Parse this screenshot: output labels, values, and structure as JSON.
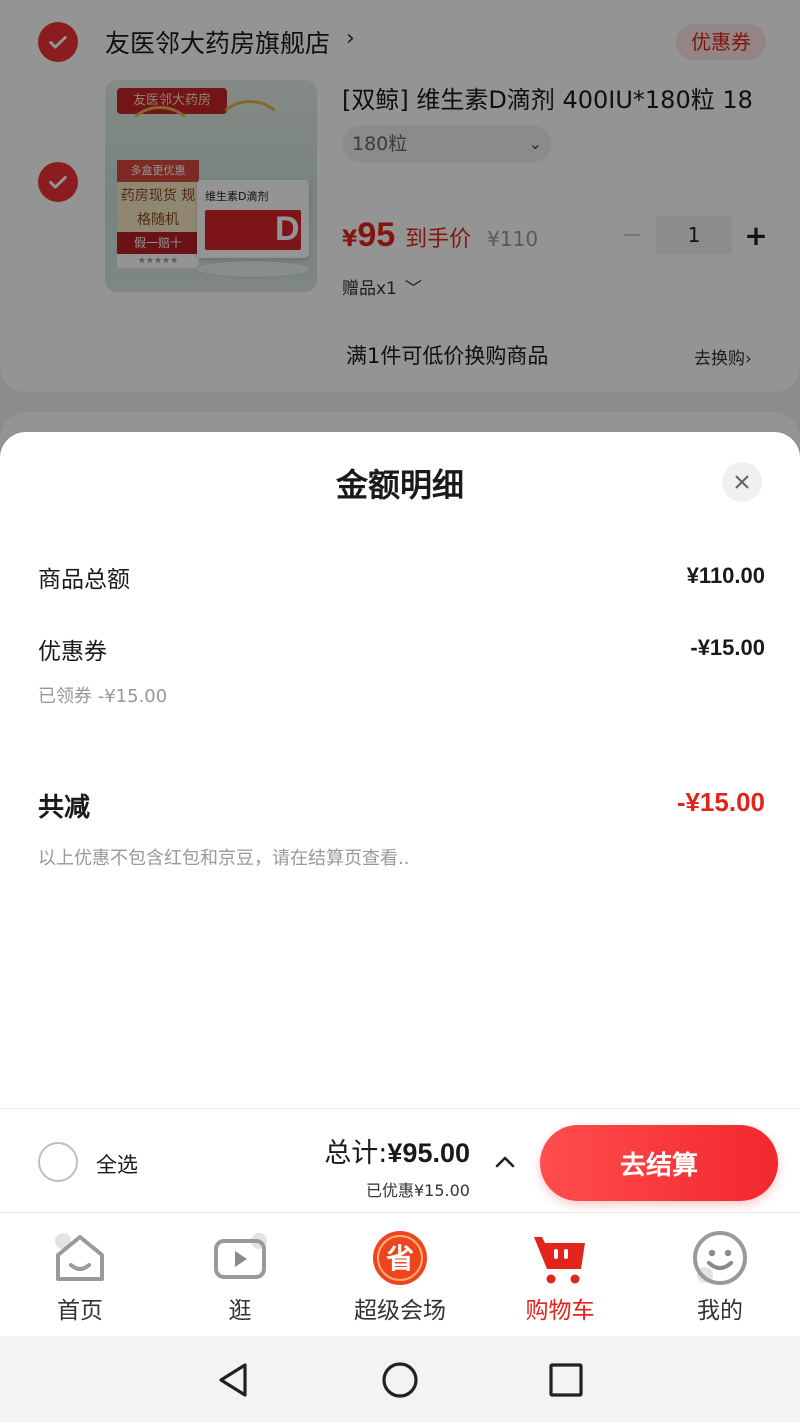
{
  "store": {
    "name": "友医邻大药房旗舰店",
    "chevron": "›",
    "coupon_tag": "优惠券"
  },
  "product": {
    "image_texts": {
      "banner": "友医邻大药房",
      "promo": "多盒更优惠",
      "poster": "药房现货 规格随机",
      "guarantee": "假一赔十",
      "stars": "★★★★★",
      "box_title": "维生素D滴剂",
      "box_letter": "D"
    },
    "title": "[双鲸] 维生素D滴剂 400IU*180粒 18",
    "spec": "180粒",
    "price_symbol": "¥",
    "price": "95",
    "price_label": "到手价",
    "original_price": "¥110",
    "qty_minus": "−",
    "quantity": "1",
    "qty_plus": "+",
    "gift": "赠品x1",
    "swap_promo": "满1件可低价换购商品",
    "swap_link": "去换购›"
  },
  "sheet": {
    "title": "金额明细",
    "rows": [
      {
        "label": "商品总额",
        "value": "¥110.00"
      },
      {
        "label": "优惠券",
        "value": "-¥15.00",
        "note": "已领券 -¥15.00"
      }
    ],
    "total_label": "共减",
    "total_value": "-¥15.00",
    "disclaimer": "以上优惠不包含红包和京豆，请在结算页查看.."
  },
  "checkout": {
    "select_all": "全选",
    "total_prefix": "总计:",
    "total_amount": "¥95.00",
    "saved": "已优惠¥15.00",
    "button": "去结算"
  },
  "tabbar": {
    "items": [
      {
        "label": "首页",
        "icon": "home-icon",
        "active": false
      },
      {
        "label": "逛",
        "icon": "video-play-icon",
        "active": false
      },
      {
        "label": "超级会场",
        "icon": "super-venue-icon",
        "active": false,
        "icon_glyph": "省"
      },
      {
        "label": "购物车",
        "icon": "cart-icon",
        "active": true
      },
      {
        "label": "我的",
        "icon": "smiley-icon",
        "active": false
      }
    ]
  },
  "colors": {
    "accent_red": "#e1251b",
    "checkout_red": "#f2272e"
  }
}
